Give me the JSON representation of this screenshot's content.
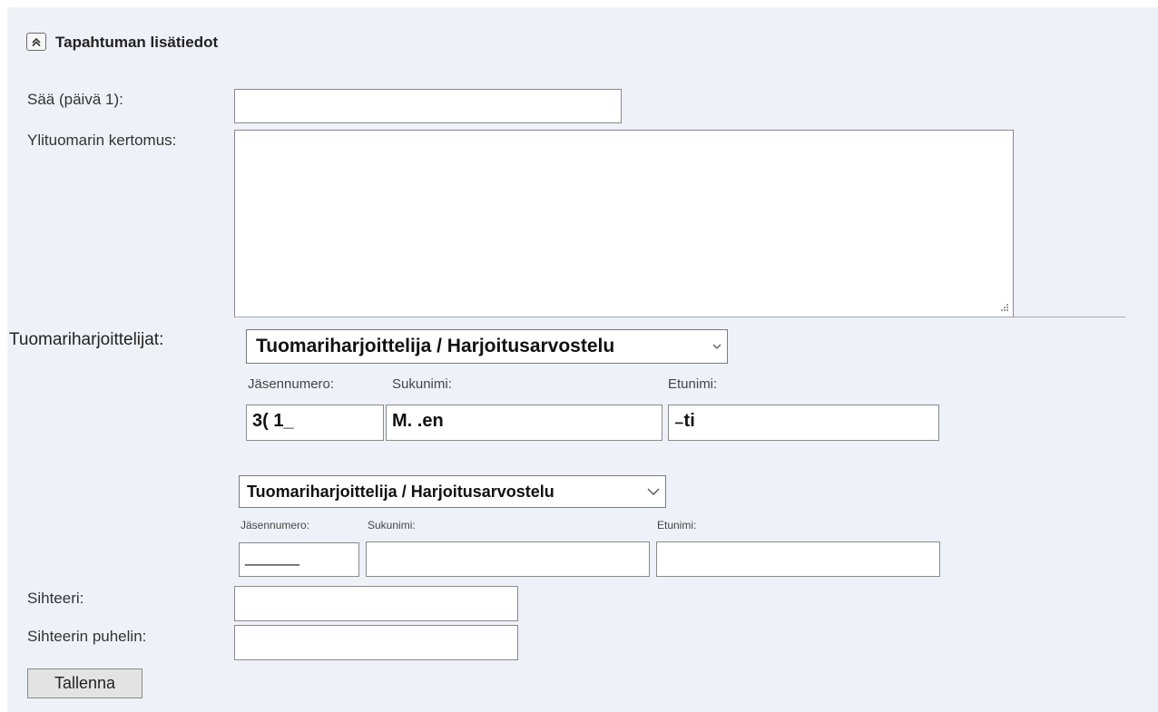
{
  "section": {
    "title": "Tapahtuman lisätiedot",
    "collapse_icon": "double-chevron-up-icon"
  },
  "fields": {
    "weather_label": "Sää (päivä 1):",
    "weather_value": "",
    "report_label": "Ylituomarin kertomus:",
    "report_value": "",
    "trainees_label": "Tuomariharjoittelijat:",
    "secretary_label": "Sihteeri:",
    "secretary_value": "",
    "secretary_phone_label": "Sihteerin puhelin:",
    "secretary_phone_value": ""
  },
  "trainees": [
    {
      "role_selected": "Tuomariharjoittelija / Harjoitusarvostelu",
      "member_number_label": "Jäsennumero:",
      "surname_label": "Sukunimi:",
      "firstname_label": "Etunimi:",
      "member_number_value": "3(   1_",
      "surname_value": "M.        .en",
      "firstname_value": "  ₋ti"
    },
    {
      "role_selected": "Tuomariharjoittelija / Harjoitusarvostelu",
      "member_number_label": "Jäsennumero:",
      "surname_label": "Sukunimi:",
      "firstname_label": "Etunimi:",
      "member_number_value": "______",
      "surname_value": "",
      "firstname_value": ""
    }
  ],
  "actions": {
    "save_label": "Tallenna"
  }
}
